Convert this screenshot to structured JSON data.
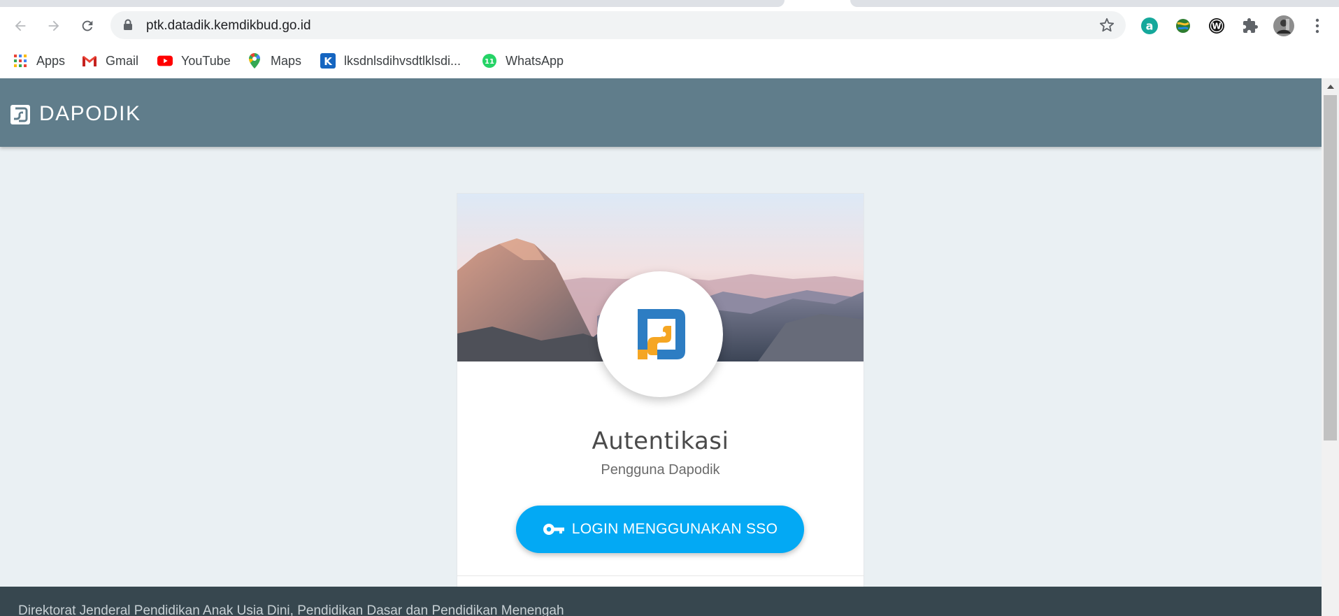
{
  "browser": {
    "url": "ptk.datadik.kemdikbud.go.id",
    "icons": {
      "back": "arrow-left-icon",
      "forward": "arrow-right-icon",
      "reload": "reload-icon",
      "lock": "lock-icon",
      "bookmark_star": "star-icon",
      "extensions": [
        "grammarly-icon",
        "globe-extension-icon",
        "wordpress-icon",
        "puzzle-icon",
        "profile-avatar",
        "menu-dots-icon"
      ]
    },
    "bookmarks": [
      {
        "label": "Apps",
        "icon": "apps-grid-icon"
      },
      {
        "label": "Gmail",
        "icon": "gmail-icon"
      },
      {
        "label": "YouTube",
        "icon": "youtube-icon"
      },
      {
        "label": "Maps",
        "icon": "maps-pin-icon"
      },
      {
        "label": "lksdnlsdihvsdtlklsdi...",
        "icon": "k-logo-icon"
      },
      {
        "label": "WhatsApp",
        "icon": "whatsapp-icon"
      }
    ],
    "whatsapp_badge": "11"
  },
  "header": {
    "title": "DAPODIK",
    "background": "#607d8b"
  },
  "card": {
    "title": "Autentikasi",
    "subtitle": "Pengguna Dapodik",
    "login_button": "LOGIN MENGGUNAKAN SSO",
    "button_color": "#03a9f4",
    "logo_colors": {
      "blue": "#2d7dc3",
      "orange": "#f5a623"
    }
  },
  "footer": {
    "text": "Direktorat Jenderal Pendidikan Anak Usia Dini, Pendidikan Dasar dan Pendidikan Menengah"
  }
}
